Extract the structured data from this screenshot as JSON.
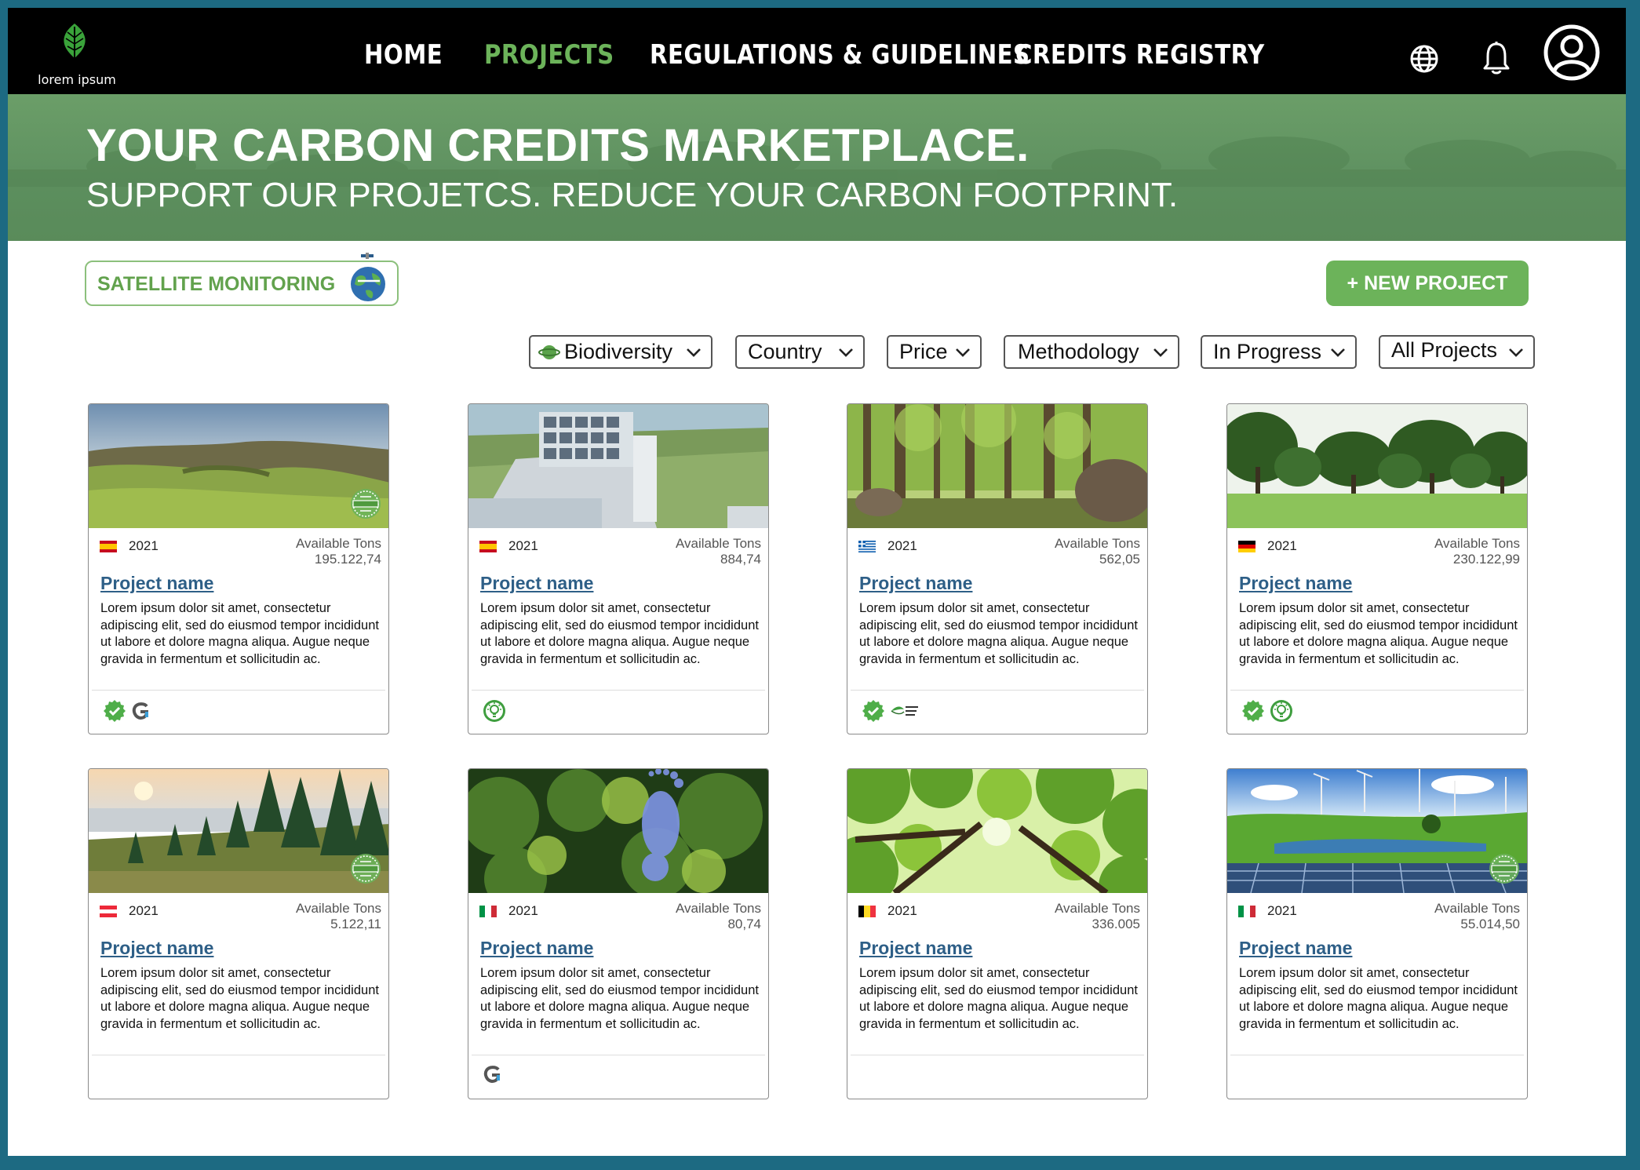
{
  "brand": {
    "logo_text": "lorem ipsum"
  },
  "nav": {
    "links": [
      "HOME",
      "PROJECTS",
      "REGULATIONS & GUIDELINES",
      "CREDITS REGISTRY"
    ],
    "active": "PROJECTS"
  },
  "hero": {
    "title": "YOUR CARBON CREDITS MARKETPLACE.",
    "subtitle": "SUPPORT OUR PROJETCS. REDUCE YOUR CARBON FOOTPRINT."
  },
  "actions": {
    "satellite_label": "SATELLITE MONITORING",
    "new_project_label": "+ NEW PROJECT"
  },
  "filters": [
    "Biodiversity",
    "Country",
    "Price",
    "Methodology",
    "In Progress",
    "All Projects"
  ],
  "colors": {
    "accent": "#6cb35a",
    "link": "#2e5f87",
    "hero": "#5e9060"
  },
  "cards": [
    {
      "country": "Spain",
      "flag": "spain",
      "year": "2021",
      "available_label": "Available Tons",
      "available": "195.122,74",
      "name": "Project name",
      "description": "Lorem ipsum dolor sit amet, consectetur adipiscing elit, sed do eiusmod tempor incididunt ut labore et dolore magna aliqua. Augue neque gravida in fermentum et sollicitudin ac.",
      "badges": [
        "verified-check-icon",
        "g-logo-icon"
      ],
      "seal": true
    },
    {
      "country": "Spain",
      "flag": "spain",
      "year": "2021",
      "available_label": "Available Tons",
      "available": "884,74",
      "name": "Project name",
      "description": "Lorem ipsum dolor sit amet, consectetur adipiscing elit, sed do eiusmod tempor incididunt ut labore et dolore magna aliqua. Augue neque gravida in fermentum et sollicitudin ac.",
      "badges": [
        "bulb-seal-icon"
      ],
      "seal": false
    },
    {
      "country": "Greece",
      "flag": "greece",
      "year": "2021",
      "available_label": "Available Tons",
      "available": "562,05",
      "name": "Project name",
      "description": "Lorem ipsum dolor sit amet, consectetur adipiscing elit, sed do eiusmod tempor incididunt ut labore et dolore magna aliqua. Augue neque gravida in fermentum et sollicitudin ac.",
      "badges": [
        "verified-check-icon",
        "american-carbon-registry-icon"
      ],
      "seal": false
    },
    {
      "country": "Germany",
      "flag": "germany",
      "year": "2021",
      "available_label": "Available Tons",
      "available": "230.122,99",
      "name": "Project name",
      "description": "Lorem ipsum dolor sit amet, consectetur adipiscing elit, sed do eiusmod tempor incididunt ut labore et dolore magna aliqua. Augue neque gravida in fermentum et sollicitudin ac.",
      "badges": [
        "verified-check-icon",
        "bulb-seal-icon"
      ],
      "seal": false
    },
    {
      "country": "Austria",
      "flag": "austria",
      "year": "2021",
      "available_label": "Available Tons",
      "available": "5.122,11",
      "name": "Project name",
      "description": "Lorem ipsum dolor sit amet, consectetur adipiscing elit, sed do eiusmod tempor incididunt ut labore et dolore magna aliqua. Augue neque gravida in fermentum et sollicitudin ac.",
      "badges": [],
      "seal": true
    },
    {
      "country": "Italy",
      "flag": "italy",
      "year": "2021",
      "available_label": "Available Tons",
      "available": "80,74",
      "name": "Project name",
      "description": "Lorem ipsum dolor sit amet, consectetur adipiscing elit, sed do eiusmod tempor incididunt ut labore et dolore magna aliqua. Augue neque gravida in fermentum et sollicitudin ac.",
      "badges": [
        "g-logo-icon"
      ],
      "seal": false
    },
    {
      "country": "Belgium",
      "flag": "belgium",
      "year": "2021",
      "available_label": "Available Tons",
      "available": "336.005",
      "name": "Project name",
      "description": "Lorem ipsum dolor sit amet, consectetur adipiscing elit, sed do eiusmod tempor incididunt ut labore et dolore magna aliqua. Augue neque gravida in fermentum et sollicitudin ac.",
      "badges": [],
      "seal": false
    },
    {
      "country": "Italy",
      "flag": "italy",
      "year": "2021",
      "available_label": "Available Tons",
      "available": "55.014,50",
      "name": "Project name",
      "description": "Lorem ipsum dolor sit amet, consectetur adipiscing elit, sed do eiusmod tempor incididunt ut labore et dolore magna aliqua. Augue neque gravida in fermentum et sollicitudin ac.",
      "badges": [],
      "seal": true
    }
  ]
}
